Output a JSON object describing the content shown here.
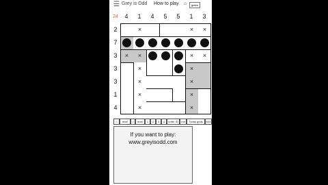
{
  "header": {
    "menu_glyph": "☰",
    "title": "Grey is Odd",
    "how_to_play": "How to play",
    "home_glyph": "⌂",
    "chip_label": "green"
  },
  "puzzle": {
    "counter": "24",
    "column_clues": [
      "4",
      "1",
      "4",
      "5",
      "5",
      "1",
      "3"
    ],
    "row_clues": [
      "2",
      "7",
      "3",
      "3",
      "3",
      "1",
      "4"
    ],
    "cross_glyph": "×"
  },
  "controls": {
    "prev": "<",
    "level_name": "level",
    "next": ">",
    "level": "level",
    "b1": "1",
    "b2": "2",
    "b3": "3",
    "b4": "4",
    "enter_id": "enter ID",
    "rnd": "rnd",
    "todays_grids": "Today grids",
    "size": "6X6"
  },
  "message": {
    "line1": "If you want to play:",
    "line2": "www.greyisodd.com"
  },
  "colors": {
    "grey_cell": "#c8c8c8",
    "counter": "#e05a2a",
    "background": "#000000"
  }
}
